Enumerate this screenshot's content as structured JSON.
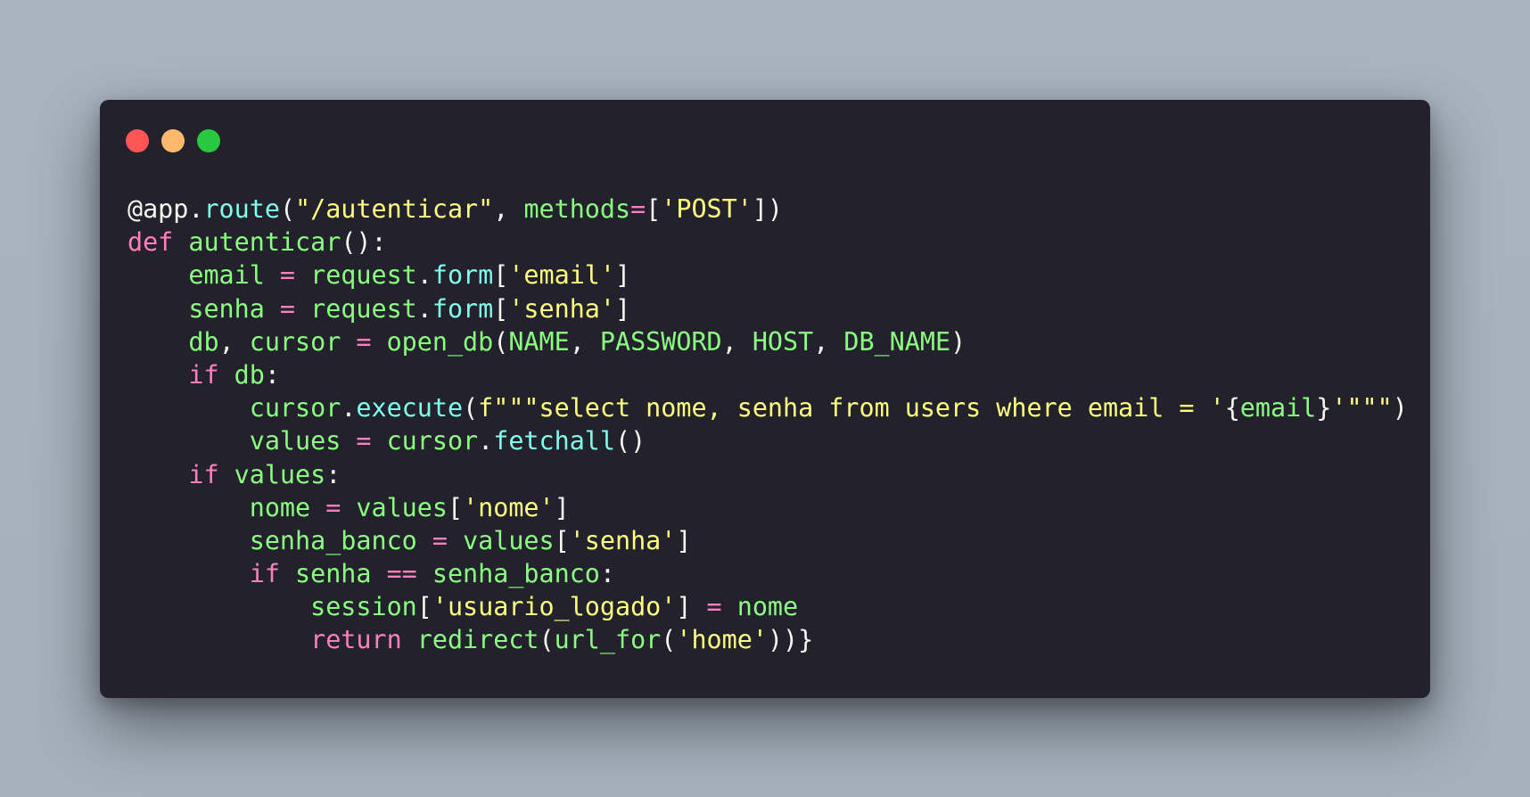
{
  "window": {
    "controls": [
      {
        "name": "close",
        "color": "#ff5555"
      },
      {
        "name": "minimize",
        "color": "#ffb86c"
      },
      {
        "name": "maximize",
        "color": "#28c840"
      }
    ]
  },
  "theme": {
    "background": "#22212c",
    "plain": "#f8f8f2",
    "function": "#8aff80",
    "attribute": "#80ffea",
    "string": "#ffff80",
    "keyword": "#ff80bf"
  },
  "code": {
    "language": "python",
    "lines": [
      [
        {
          "t": "plain",
          "v": "@app."
        },
        {
          "t": "attr",
          "v": "route"
        },
        {
          "t": "plain",
          "v": "("
        },
        {
          "t": "str",
          "v": "\"/autenticar\""
        },
        {
          "t": "plain",
          "v": ", "
        },
        {
          "t": "fn",
          "v": "methods"
        },
        {
          "t": "op",
          "v": "="
        },
        {
          "t": "plain",
          "v": "["
        },
        {
          "t": "str",
          "v": "'POST'"
        },
        {
          "t": "plain",
          "v": "])"
        }
      ],
      [
        {
          "t": "kw",
          "v": "def "
        },
        {
          "t": "fn",
          "v": "autenticar"
        },
        {
          "t": "plain",
          "v": "():"
        }
      ],
      [
        {
          "t": "plain",
          "v": "    "
        },
        {
          "t": "fn",
          "v": "email"
        },
        {
          "t": "op",
          "v": " = "
        },
        {
          "t": "fn",
          "v": "request"
        },
        {
          "t": "plain",
          "v": "."
        },
        {
          "t": "attr",
          "v": "form"
        },
        {
          "t": "plain",
          "v": "["
        },
        {
          "t": "str",
          "v": "'email'"
        },
        {
          "t": "plain",
          "v": "]"
        }
      ],
      [
        {
          "t": "plain",
          "v": "    "
        },
        {
          "t": "fn",
          "v": "senha"
        },
        {
          "t": "op",
          "v": " = "
        },
        {
          "t": "fn",
          "v": "request"
        },
        {
          "t": "plain",
          "v": "."
        },
        {
          "t": "attr",
          "v": "form"
        },
        {
          "t": "plain",
          "v": "["
        },
        {
          "t": "str",
          "v": "'senha'"
        },
        {
          "t": "plain",
          "v": "]"
        }
      ],
      [
        {
          "t": "plain",
          "v": "    "
        },
        {
          "t": "fn",
          "v": "db"
        },
        {
          "t": "plain",
          "v": ", "
        },
        {
          "t": "fn",
          "v": "cursor"
        },
        {
          "t": "op",
          "v": " = "
        },
        {
          "t": "fn",
          "v": "open_db"
        },
        {
          "t": "plain",
          "v": "("
        },
        {
          "t": "fn",
          "v": "NAME"
        },
        {
          "t": "plain",
          "v": ", "
        },
        {
          "t": "fn",
          "v": "PASSWORD"
        },
        {
          "t": "plain",
          "v": ", "
        },
        {
          "t": "fn",
          "v": "HOST"
        },
        {
          "t": "plain",
          "v": ", "
        },
        {
          "t": "fn",
          "v": "DB_NAME"
        },
        {
          "t": "plain",
          "v": ")"
        }
      ],
      [
        {
          "t": "plain",
          "v": "    "
        },
        {
          "t": "kw",
          "v": "if "
        },
        {
          "t": "fn",
          "v": "db"
        },
        {
          "t": "plain",
          "v": ":"
        }
      ],
      [
        {
          "t": "plain",
          "v": "        "
        },
        {
          "t": "fn",
          "v": "cursor"
        },
        {
          "t": "plain",
          "v": "."
        },
        {
          "t": "attr",
          "v": "execute"
        },
        {
          "t": "plain",
          "v": "("
        },
        {
          "t": "str",
          "v": "f\"\"\"select nome, senha from users where email = '"
        },
        {
          "t": "plain",
          "v": "{"
        },
        {
          "t": "fn",
          "v": "email"
        },
        {
          "t": "plain",
          "v": "}"
        },
        {
          "t": "str",
          "v": "'\"\"\""
        },
        {
          "t": "plain",
          "v": ")"
        }
      ],
      [
        {
          "t": "plain",
          "v": "        "
        },
        {
          "t": "fn",
          "v": "values"
        },
        {
          "t": "op",
          "v": " = "
        },
        {
          "t": "fn",
          "v": "cursor"
        },
        {
          "t": "plain",
          "v": "."
        },
        {
          "t": "attr",
          "v": "fetchall"
        },
        {
          "t": "plain",
          "v": "()"
        }
      ],
      [
        {
          "t": "plain",
          "v": "    "
        },
        {
          "t": "kw",
          "v": "if "
        },
        {
          "t": "fn",
          "v": "values"
        },
        {
          "t": "plain",
          "v": ":"
        }
      ],
      [
        {
          "t": "plain",
          "v": "        "
        },
        {
          "t": "fn",
          "v": "nome"
        },
        {
          "t": "op",
          "v": " = "
        },
        {
          "t": "fn",
          "v": "values"
        },
        {
          "t": "plain",
          "v": "["
        },
        {
          "t": "str",
          "v": "'nome'"
        },
        {
          "t": "plain",
          "v": "]"
        }
      ],
      [
        {
          "t": "plain",
          "v": "        "
        },
        {
          "t": "fn",
          "v": "senha_banco"
        },
        {
          "t": "op",
          "v": " = "
        },
        {
          "t": "fn",
          "v": "values"
        },
        {
          "t": "plain",
          "v": "["
        },
        {
          "t": "str",
          "v": "'senha'"
        },
        {
          "t": "plain",
          "v": "]"
        }
      ],
      [
        {
          "t": "plain",
          "v": "        "
        },
        {
          "t": "kw",
          "v": "if "
        },
        {
          "t": "fn",
          "v": "senha"
        },
        {
          "t": "op",
          "v": " == "
        },
        {
          "t": "fn",
          "v": "senha_banco"
        },
        {
          "t": "plain",
          "v": ":"
        }
      ],
      [
        {
          "t": "plain",
          "v": "            "
        },
        {
          "t": "fn",
          "v": "session"
        },
        {
          "t": "plain",
          "v": "["
        },
        {
          "t": "str",
          "v": "'usuario_logado'"
        },
        {
          "t": "plain",
          "v": "]"
        },
        {
          "t": "op",
          "v": " = "
        },
        {
          "t": "fn",
          "v": "nome"
        }
      ],
      [
        {
          "t": "plain",
          "v": "            "
        },
        {
          "t": "kw",
          "v": "return "
        },
        {
          "t": "fn",
          "v": "redirect"
        },
        {
          "t": "plain",
          "v": "("
        },
        {
          "t": "fn",
          "v": "url_for"
        },
        {
          "t": "plain",
          "v": "("
        },
        {
          "t": "str",
          "v": "'home'"
        },
        {
          "t": "plain",
          "v": "))}"
        }
      ]
    ]
  }
}
